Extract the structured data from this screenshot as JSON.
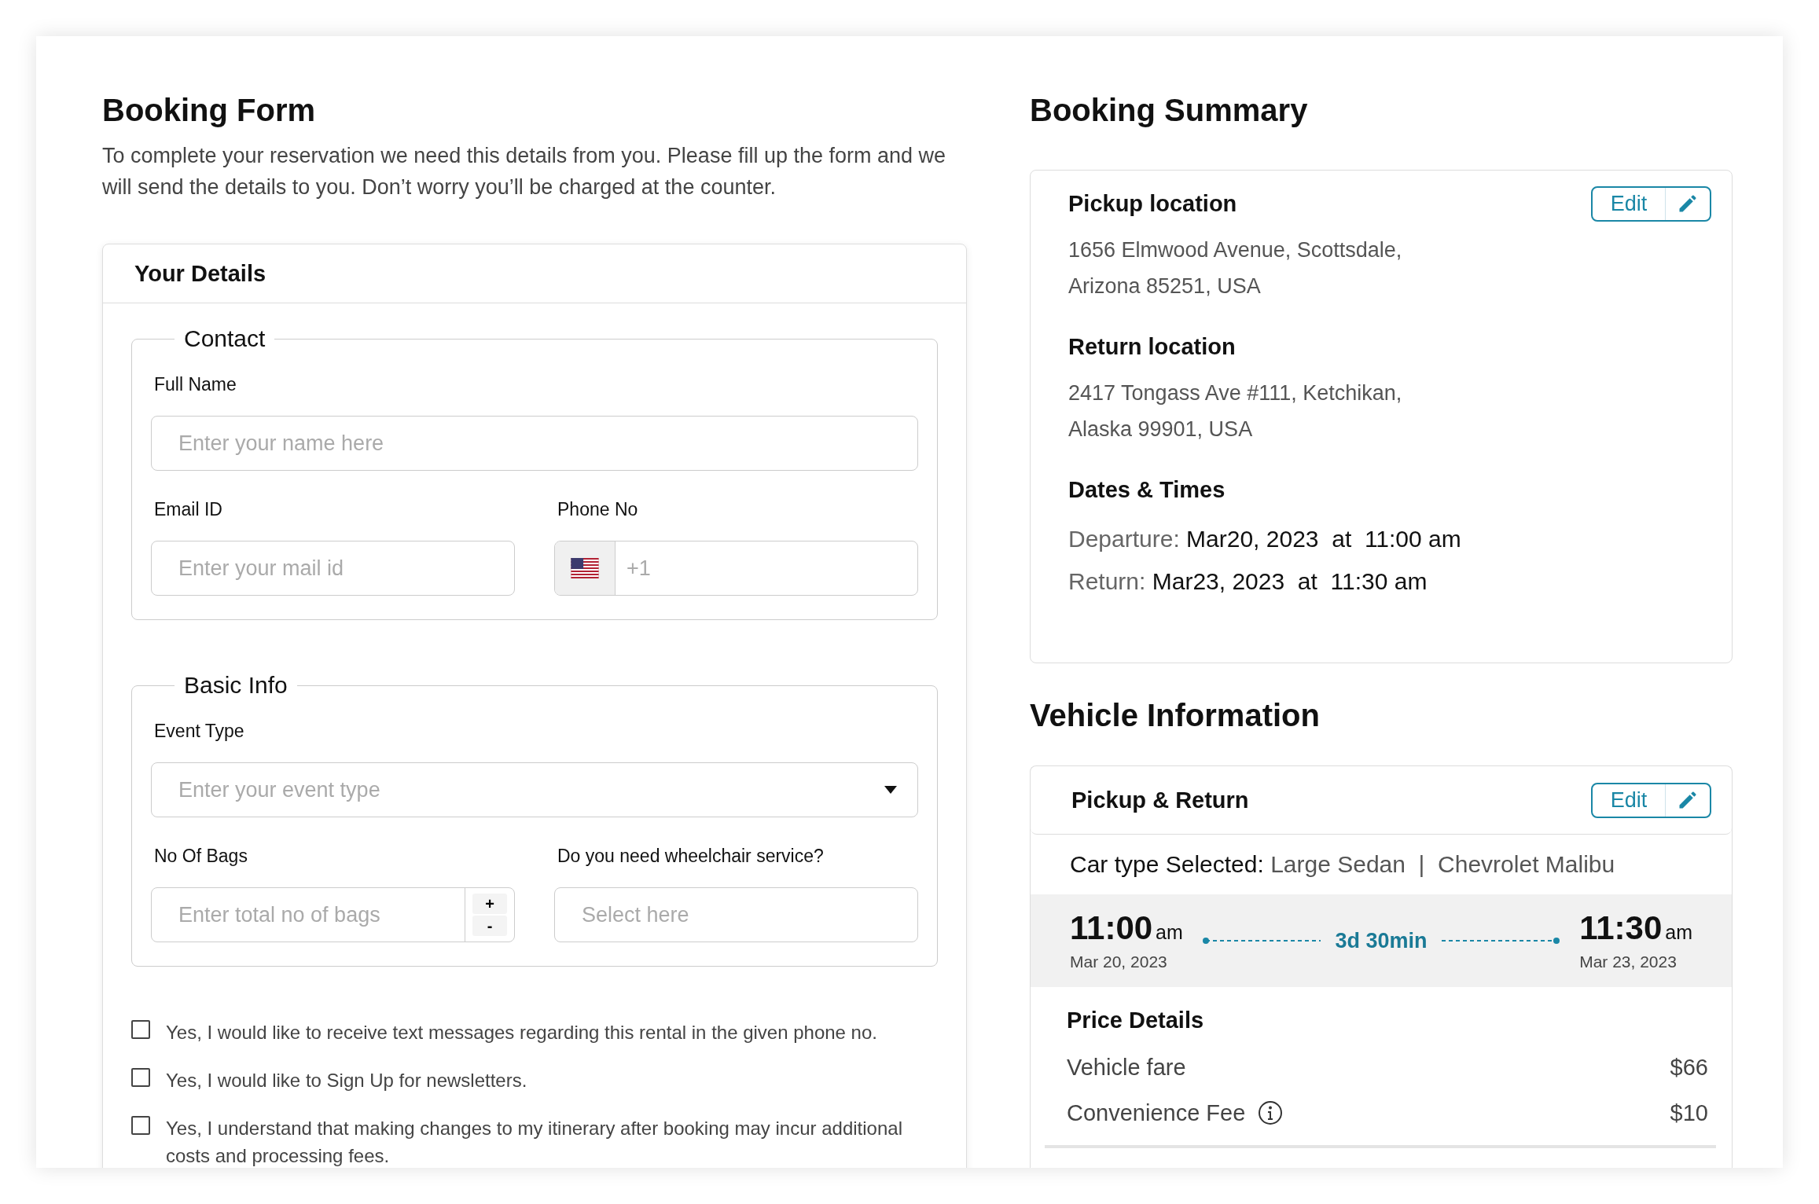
{
  "booking_form": {
    "title": "Booking Form",
    "description": "To complete your reservation we need this details from you. Please fill up the form and we will send the details to you. Don’t worry you’ll be charged at the counter.",
    "details_card": {
      "title": "Your Details",
      "sections": [
        {
          "legend": "Contact",
          "rows": [
            [
              {
                "kind": "text",
                "label": "Full Name",
                "placeholder": "Enter your name here"
              }
            ],
            [
              {
                "kind": "text",
                "label": "Email ID",
                "placeholder": "Enter your mail id"
              },
              {
                "kind": "phone",
                "label": "Phone No",
                "placeholder": "+1"
              }
            ]
          ]
        },
        {
          "legend": "Basic Info",
          "rows": [
            [
              {
                "kind": "select",
                "label": "Event Type",
                "placeholder": "Enter your event type"
              }
            ],
            [
              {
                "kind": "number",
                "label": "No Of Bags",
                "placeholder": "Enter total no of bags",
                "increment": "+",
                "decrement": "-"
              },
              {
                "kind": "text",
                "label": "Do you need wheelchair service?",
                "placeholder": "Select here"
              }
            ]
          ]
        }
      ],
      "consents": [
        {
          "text": "Yes, I would like to receive text messages regarding  this rental in the given phone no.",
          "checked": false
        },
        {
          "text": "Yes, I would like to Sign Up for newsletters.",
          "checked": false
        },
        {
          "text": "Yes, I understand that making changes to my itinerary after booking may incur additional costs and processing fees.",
          "checked": false
        }
      ]
    }
  },
  "booking_summary": {
    "title": "Booking Summary",
    "edit_button": "Edit",
    "sections": [
      {
        "kind": "address",
        "heading": "Pickup location",
        "lines": [
          "1656 Elmwood Avenue, Scottsdale,",
          "Arizona 85251, USA"
        ]
      },
      {
        "kind": "address",
        "heading": "Return location",
        "lines": [
          "2417 Tongass Ave #111, Ketchikan,",
          "Alaska 99901, USA"
        ]
      },
      {
        "kind": "dates",
        "heading": "Dates & Times",
        "entries": [
          {
            "label": "Departure:",
            "value": "Mar20, 2023  at  11:00 am"
          },
          {
            "label": "Return:",
            "value": "Mar23, 2023  at  11:30 am"
          }
        ]
      }
    ]
  },
  "vehicle_information": {
    "title": "Vehicle Information",
    "card_title": "Pickup & Return",
    "edit_button": "Edit",
    "car_type": {
      "label": "Car type Selected:",
      "value": "Large Sedan  |  Chevrolet Malibu"
    },
    "trip": {
      "pickup": {
        "time": "11:00",
        "period": "am",
        "date": "Mar 20, 2023"
      },
      "duration": "3d 30min",
      "return": {
        "time": "11:30",
        "period": "am",
        "date": "Mar 23, 2023"
      }
    },
    "price_details": {
      "title": "Price Details",
      "items": [
        {
          "kind": "plain",
          "label": "Vehicle fare",
          "amount": "$66"
        },
        {
          "kind": "info",
          "label": "Convenience Fee",
          "amount": "$10"
        }
      ]
    }
  }
}
